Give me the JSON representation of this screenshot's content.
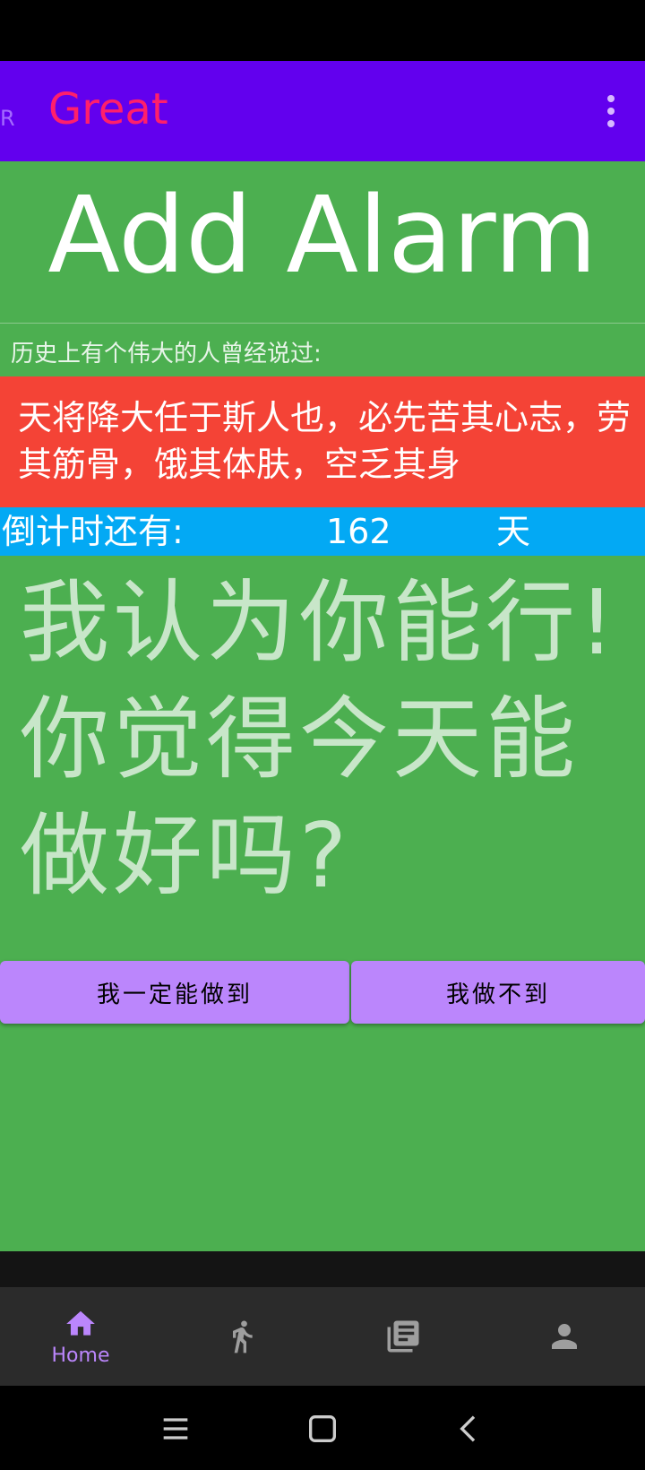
{
  "app_bar": {
    "nav_letter": "R",
    "title": "Great"
  },
  "main": {
    "heading": "Add Alarm",
    "quote_intro": "历史上有个伟大的人曾经说过:",
    "quote": "天将降大任于斯人也，必先苦其心志，劳其筋骨，饿其体肤，空乏其身",
    "countdown": {
      "label": "倒计时还有:",
      "value": "162",
      "unit": "天"
    },
    "encouragement": "我认为你能行!你觉得今天能做好吗?",
    "buttons": {
      "yes_label": "我一定能做到",
      "no_label": "我做不到"
    }
  },
  "bottom_nav": {
    "items": [
      {
        "label": "Home",
        "icon": "home-icon",
        "active": true
      },
      {
        "label": "",
        "icon": "run-icon",
        "active": false
      },
      {
        "label": "",
        "icon": "library-icon",
        "active": false
      },
      {
        "label": "",
        "icon": "person-icon",
        "active": false
      }
    ]
  },
  "colors": {
    "app_bar": "#6200EE",
    "title": "#FF1F6B",
    "content_bg": "#4CAF50",
    "quote_bg": "#F44336",
    "countdown_bg": "#03A9F4",
    "button": "#BB86FC",
    "nav_active": "#BB86FC",
    "nav_inactive": "#9E9E9E"
  }
}
